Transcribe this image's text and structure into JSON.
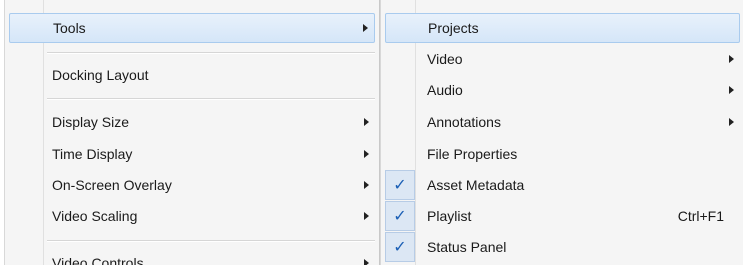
{
  "left_menu": {
    "items": [
      {
        "label": "Tools",
        "submenu": true
      },
      {
        "label": "Docking Layout",
        "submenu": false
      },
      {
        "label": "Display Size",
        "submenu": true
      },
      {
        "label": "Time Display",
        "submenu": true
      },
      {
        "label": "On-Screen Overlay",
        "submenu": true
      },
      {
        "label": "Video Scaling",
        "submenu": true
      },
      {
        "label": "Video Controls",
        "submenu": true
      }
    ]
  },
  "right_menu": {
    "items": [
      {
        "label": "Projects",
        "checked": false,
        "submenu": false,
        "shortcut": ""
      },
      {
        "label": "Video",
        "checked": false,
        "submenu": true,
        "shortcut": ""
      },
      {
        "label": "Audio",
        "checked": false,
        "submenu": true,
        "shortcut": ""
      },
      {
        "label": "Annotations",
        "checked": false,
        "submenu": true,
        "shortcut": ""
      },
      {
        "label": "File Properties",
        "checked": false,
        "submenu": false,
        "shortcut": ""
      },
      {
        "label": "Asset Metadata",
        "checked": true,
        "submenu": false,
        "shortcut": ""
      },
      {
        "label": "Playlist",
        "checked": true,
        "submenu": false,
        "shortcut": "Ctrl+F1"
      },
      {
        "label": "Status Panel",
        "checked": true,
        "submenu": false,
        "shortcut": ""
      }
    ]
  },
  "icons": {
    "check": "✓",
    "submenu_arrow": "chevron-right-icon"
  },
  "colors": {
    "hover_bg": "#d5e6f8",
    "check": "#1b5fb5"
  }
}
